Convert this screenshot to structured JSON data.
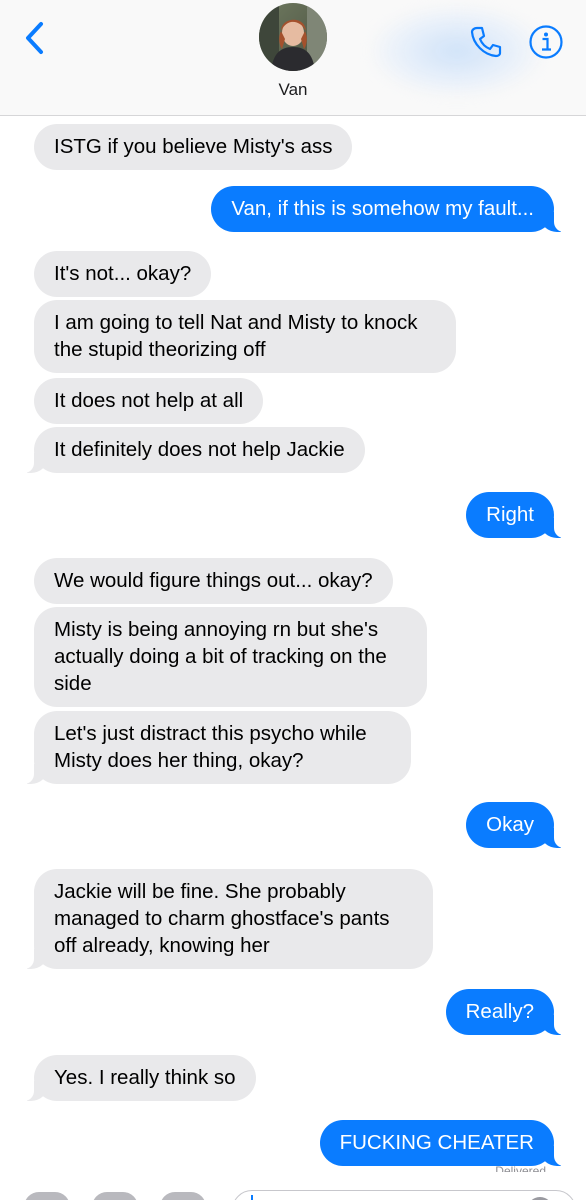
{
  "header": {
    "contact_name": "Van",
    "icons": {
      "back": "chevron-left-icon",
      "phone": "phone-icon",
      "info": "info-icon"
    },
    "accent_color": "#0a7cff"
  },
  "messages": [
    {
      "direction": "received",
      "text": "ISTG if you believe Misty's ass"
    },
    {
      "direction": "sent",
      "text": "Van, if this is somehow my fault..."
    },
    {
      "direction": "received",
      "text": "It's not... okay?"
    },
    {
      "direction": "received",
      "text": "I am going to tell Nat and Misty to knock the stupid theorizing off"
    },
    {
      "direction": "received",
      "text": "It does not help at all"
    },
    {
      "direction": "received",
      "text": "It definitely does not help Jackie"
    },
    {
      "direction": "sent",
      "text": "Right"
    },
    {
      "direction": "received",
      "text": "We would figure things out... okay?"
    },
    {
      "direction": "received",
      "text": "Misty is being annoying rn but she's actually doing a bit of tracking on the side"
    },
    {
      "direction": "received",
      "text": "Let's just distract this psycho while Misty does her thing, okay?"
    },
    {
      "direction": "sent",
      "text": "Okay"
    },
    {
      "direction": "received",
      "text": "Jackie will be fine. She probably managed to charm ghostface's pants off already, knowing her"
    },
    {
      "direction": "sent",
      "text": "Really?"
    },
    {
      "direction": "received",
      "text": "Yes. I really think so"
    },
    {
      "direction": "sent",
      "text": "FUCKING CHEATER"
    }
  ],
  "footer": {
    "status": "Delivered"
  },
  "colors": {
    "sent_bubble": "#0a7cff",
    "received_bubble": "#e9e9eb"
  }
}
